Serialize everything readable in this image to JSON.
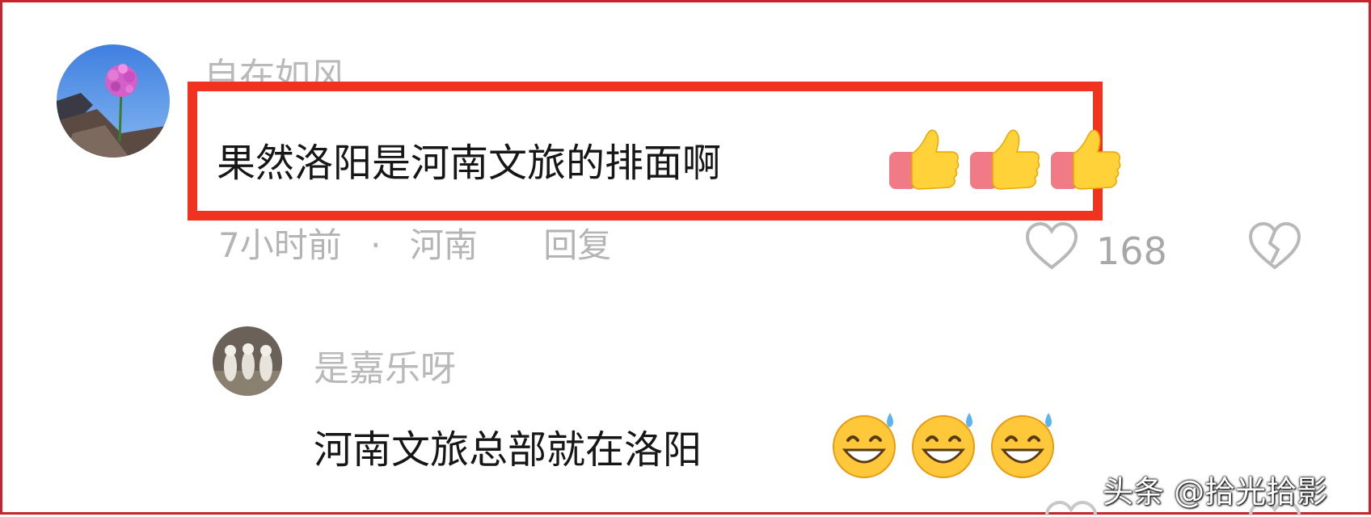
{
  "comments": [
    {
      "username": "自在如风",
      "text": "果然洛阳是河南文旅的排面啊",
      "emoji": "thumbs-up",
      "emoji_count": 3,
      "meta": {
        "time": "7小时前",
        "separator": "·",
        "location": "河南",
        "reply_label": "回复"
      },
      "likes": "168",
      "highlighted": true
    },
    {
      "username": "是嘉乐呀",
      "text": "河南文旅总部就在洛阳",
      "emoji": "grinning-sweat",
      "emoji_count": 3,
      "highlighted": false
    }
  ],
  "watermark": "头条 @拾光拾影",
  "colors": {
    "highlight_border": "#f0321e",
    "outer_frame": "#c8232c",
    "username_gray": "#b9b9b9",
    "text_dark": "#161616"
  }
}
